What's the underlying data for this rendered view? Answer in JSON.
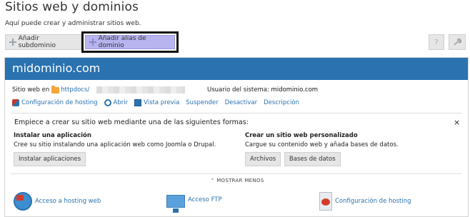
{
  "page": {
    "title": "Sitios web y dominios",
    "subtitle": "Aquí puede crear y administrar sitios web."
  },
  "toolbar": {
    "add_subdomain": "Añadir subdominio",
    "add_alias": "Añadir alias de dominio",
    "help": "?"
  },
  "domain": {
    "name": "midominio.com",
    "site_in_label": "Sitio web en",
    "docroot": "httpdocs/",
    "system_user_label": "Usuario del sistema:",
    "system_user": "midominio.com"
  },
  "actions": [
    {
      "label": "Configuración de hosting",
      "icon": "hosting-settings-icon"
    },
    {
      "label": "Abrir",
      "icon": "open-icon"
    },
    {
      "label": "Vista previa",
      "icon": "preview-icon"
    },
    {
      "label": "Suspender",
      "icon": ""
    },
    {
      "label": "Desactivar",
      "icon": ""
    },
    {
      "label": "Descripción",
      "icon": ""
    }
  ],
  "start": {
    "text": "Empiece a crear su sitio web mediante una de las siguientes formas:",
    "close": "×"
  },
  "install_app": {
    "title": "Instalar una aplicación",
    "description": "Cree su sitio instalando una aplicación web como Joomla o Drupal.",
    "button": "Instalar aplicaciones"
  },
  "custom_site": {
    "title": "Crear un sitio web personalizado",
    "description": "Cargue su contenido web y añada bases de datos.",
    "files_button": "Archivos",
    "db_button": "Bases de datos"
  },
  "show_less": "MOSTRAR MENOS",
  "bottom": [
    {
      "label": "Acceso a hosting web",
      "icon": "globe-icon"
    },
    {
      "label": "Acceso FTP",
      "icon": "ftp-icon"
    },
    {
      "label": "Configuración de hosting",
      "icon": "hosting-config-icon"
    }
  ],
  "colors": {
    "header_blue": "#2a72b0",
    "highlight_button": "#b8b4f0",
    "link": "#2a72b0"
  }
}
